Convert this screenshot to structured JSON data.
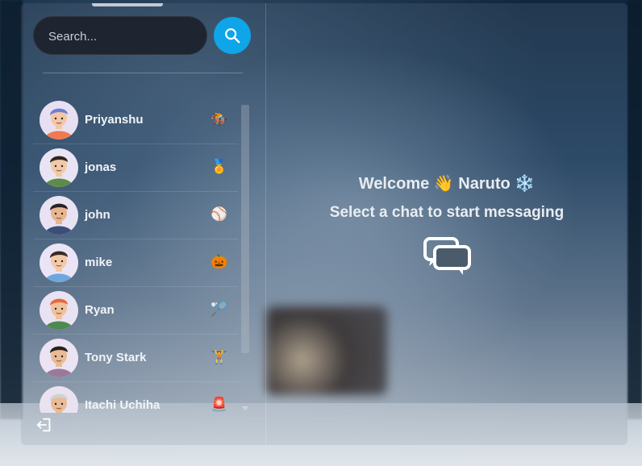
{
  "search": {
    "placeholder": "Search..."
  },
  "chats": [
    {
      "name": "Priyanshu",
      "emoji": "🏇",
      "shirt": "#f07a52",
      "hat": "#6a7fd6",
      "skin": "#f3c6a5",
      "bg": "#e8dff3"
    },
    {
      "name": "jonas",
      "emoji": "🏅",
      "shirt": "#5d8c4a",
      "hat": "#2e2420",
      "skin": "#f1c9a8",
      "bg": "#e9e4f4"
    },
    {
      "name": "john",
      "emoji": "⚾",
      "shirt": "#3c4d7a",
      "hat": "#2a2020",
      "skin": "#e7b58f",
      "bg": "#e8e2f3"
    },
    {
      "name": "mike",
      "emoji": "🎃",
      "shirt": "#6fa7dd",
      "hat": "#3a2a22",
      "skin": "#f2c9a6",
      "bg": "#ebe4f6"
    },
    {
      "name": "Ryan",
      "emoji": "🏸",
      "shirt": "#4e8a4f",
      "hat": "#e46a3c",
      "skin": "#f0c19b",
      "bg": "#e9e2f3"
    },
    {
      "name": "Tony Stark",
      "emoji": "🏋️",
      "shirt": "#9a7a9a",
      "hat": "#24201e",
      "skin": "#e9bb95",
      "bg": "#ece3f3"
    },
    {
      "name": "Itachi Uchiha",
      "emoji": "🚨",
      "shirt": "#7a5a4a",
      "hat": "#cfd2d6",
      "skin": "#e9bb95",
      "bg": "#eae2f1"
    }
  ],
  "main": {
    "welcome_prefix": "Welcome",
    "wave_emoji": "👋",
    "username": "Naruto",
    "snow_emoji": "❄️",
    "subtitle": "Select a chat to start messaging"
  },
  "colors": {
    "accent": "#0ea5e9",
    "search_bg": "#1e2530"
  },
  "icons": {
    "search": "search-icon",
    "logout": "logout-icon",
    "chat": "chat-bubbles-icon"
  }
}
